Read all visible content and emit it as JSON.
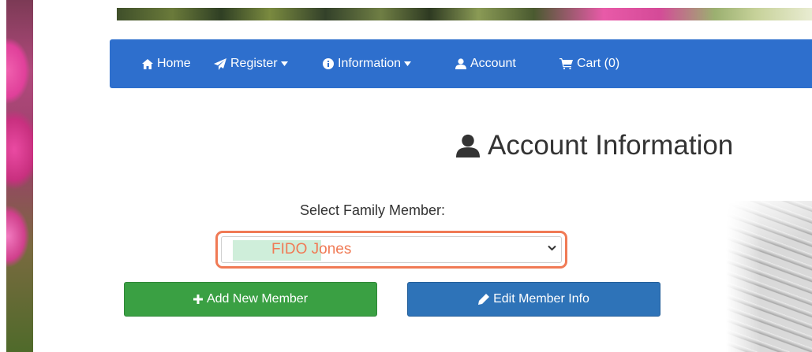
{
  "nav": {
    "home": "Home",
    "register": "Register",
    "information": "Information",
    "account": "Account",
    "cart": "Cart (0)"
  },
  "page": {
    "title": "Account Information",
    "select_label": "Select Family Member:",
    "selected_member": "FIDO Jones"
  },
  "buttons": {
    "add": "Add New Member",
    "edit": "Edit Member Info"
  },
  "colors": {
    "navbar": "#2e6fcd",
    "add_button": "#3aa043",
    "edit_button": "#2e73b8",
    "highlight_border": "#f07a55"
  },
  "icons": {
    "home": "home-icon",
    "register": "paper-plane-icon",
    "information": "info-circle-icon",
    "account": "user-icon",
    "cart": "cart-icon",
    "add": "plus-icon",
    "edit": "pencil-icon"
  }
}
